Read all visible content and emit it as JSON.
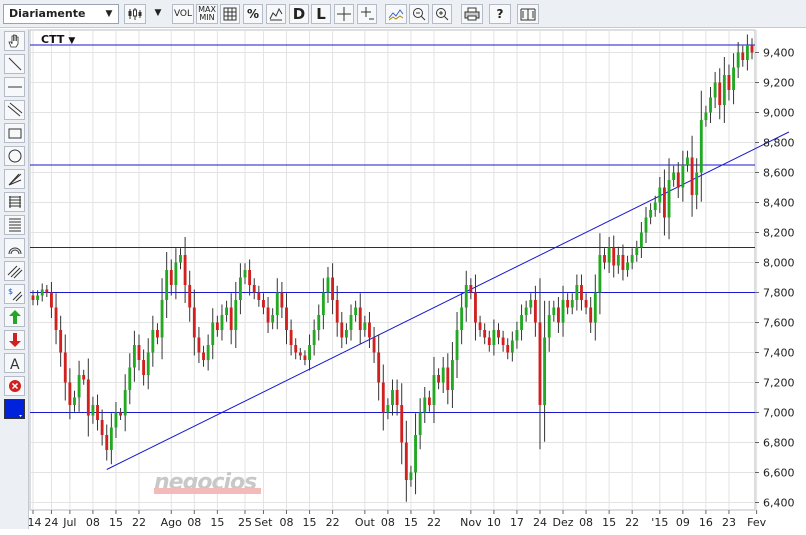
{
  "toolbar": {
    "period": "Diariamente",
    "vol_label": "VOL",
    "maxmin_top": "MAX",
    "maxmin_bottom": "MIN",
    "percent_label": "%",
    "d_label": "D",
    "l_label": "L",
    "help_label": "?"
  },
  "symbol": {
    "name": "CTT",
    "caret": "▼"
  },
  "watermark": "negocios",
  "colors": {
    "up": "#22a822",
    "down": "#d12020",
    "line": "#1a1acc",
    "grid": "#e3e3e3"
  },
  "icons": [
    "candlestick-icon",
    "chart-type-icon",
    "volume-icon",
    "maxmin-icon",
    "grid-icon",
    "percent-icon",
    "compare-icon",
    "crosshair-icon",
    "zoom-out-icon",
    "zoom-in-icon",
    "print-icon",
    "help-icon",
    "book-icon",
    "hand-icon",
    "line-icon",
    "hline-icon",
    "channel-icon",
    "rectangle-icon",
    "circle-icon",
    "fan-icon",
    "fibonacci-icon",
    "retracement-icon",
    "arc-icon",
    "parallel-icon",
    "dollar-icon",
    "buy-arrow-icon",
    "sell-arrow-icon",
    "text-icon",
    "delete-icon",
    "color-icon"
  ],
  "chart_data": {
    "type": "candlestick",
    "title": "CTT",
    "y_range": [
      6.35,
      9.55
    ],
    "y_ticks": [
      "6,400",
      "6,600",
      "6,800",
      "7,000",
      "7,200",
      "7,400",
      "7,600",
      "7,800",
      "8,000",
      "8,200",
      "8,400",
      "8,600",
      "8,800",
      "9,000",
      "9,200",
      "9,400"
    ],
    "x_labels": [
      {
        "label": "'14",
        "i": 0
      },
      {
        "label": "24",
        "i": 4
      },
      {
        "label": "Jul",
        "i": 8
      },
      {
        "label": "08",
        "i": 13
      },
      {
        "label": "15",
        "i": 18
      },
      {
        "label": "22",
        "i": 23
      },
      {
        "label": "Ago",
        "i": 30
      },
      {
        "label": "08",
        "i": 35
      },
      {
        "label": "15",
        "i": 40
      },
      {
        "label": "25",
        "i": 46
      },
      {
        "label": "Set",
        "i": 50
      },
      {
        "label": "08",
        "i": 55
      },
      {
        "label": "15",
        "i": 60
      },
      {
        "label": "22",
        "i": 65
      },
      {
        "label": "Out",
        "i": 72
      },
      {
        "label": "08",
        "i": 77
      },
      {
        "label": "15",
        "i": 82
      },
      {
        "label": "22",
        "i": 87
      },
      {
        "label": "Nov",
        "i": 95
      },
      {
        "label": "10",
        "i": 100
      },
      {
        "label": "17",
        "i": 105
      },
      {
        "label": "24",
        "i": 110
      },
      {
        "label": "Dez",
        "i": 115
      },
      {
        "label": "08",
        "i": 120
      },
      {
        "label": "15",
        "i": 125
      },
      {
        "label": "22",
        "i": 130
      },
      {
        "label": "'15",
        "i": 136
      },
      {
        "label": "09",
        "i": 141
      },
      {
        "label": "16",
        "i": 146
      },
      {
        "label": "23",
        "i": 151
      },
      {
        "label": "Fev",
        "i": 157
      }
    ],
    "horizontal_lines": [
      9.45,
      8.65,
      8.1,
      7.8,
      7.0
    ],
    "trendline": {
      "from": {
        "i": 16,
        "value": 6.62
      },
      "to": {
        "i": 164,
        "value": 8.87
      }
    },
    "series": [
      {
        "closes": [
          7.75,
          7.78,
          7.82,
          7.8,
          7.7,
          7.55,
          7.4,
          7.2,
          7.05,
          7.1,
          7.25,
          7.22,
          6.98,
          7.05,
          6.95,
          6.85,
          6.75,
          6.9,
          7.0,
          6.98,
          7.15,
          7.3,
          7.45,
          7.35,
          7.25,
          7.4,
          7.55,
          7.5,
          7.75,
          7.95,
          7.85,
          8.0,
          8.05,
          7.85,
          7.7,
          7.5,
          7.4,
          7.35,
          7.45,
          7.6,
          7.55,
          7.65,
          7.7,
          7.55,
          7.75,
          7.9,
          7.95,
          7.85,
          7.8,
          7.75,
          7.7,
          7.6,
          7.65,
          7.8,
          7.7,
          7.55,
          7.45,
          7.4,
          7.38,
          7.35,
          7.45,
          7.55,
          7.65,
          7.8,
          7.9,
          7.75,
          7.6,
          7.5,
          7.55,
          7.65,
          7.7,
          7.55,
          7.6,
          7.5,
          7.4,
          7.2,
          7.0,
          7.05,
          7.15,
          7.05,
          6.8,
          6.55,
          6.6,
          6.85,
          7.0,
          7.1,
          7.05,
          7.25,
          7.2,
          7.3,
          7.15,
          7.35,
          7.55,
          7.7,
          7.85,
          7.8,
          7.6,
          7.55,
          7.5,
          7.45,
          7.55,
          7.5,
          7.45,
          7.4,
          7.48,
          7.55,
          7.65,
          7.7,
          7.75,
          7.6,
          7.05,
          7.5,
          7.65,
          7.7,
          7.6,
          7.75,
          7.7,
          7.75,
          7.85,
          7.75,
          7.7,
          7.6,
          7.8,
          8.05,
          8.0,
          8.1,
          7.98,
          8.05,
          7.95,
          8.0,
          8.05,
          8.1,
          8.2,
          8.3,
          8.35,
          8.4,
          8.5,
          8.3,
          8.55,
          8.6,
          8.5,
          8.65,
          8.7,
          8.45,
          8.6,
          8.95,
          9.0,
          9.1,
          9.2,
          9.05,
          9.25,
          9.15,
          9.3,
          9.4,
          9.35,
          9.45,
          9.4
        ]
      }
    ]
  }
}
